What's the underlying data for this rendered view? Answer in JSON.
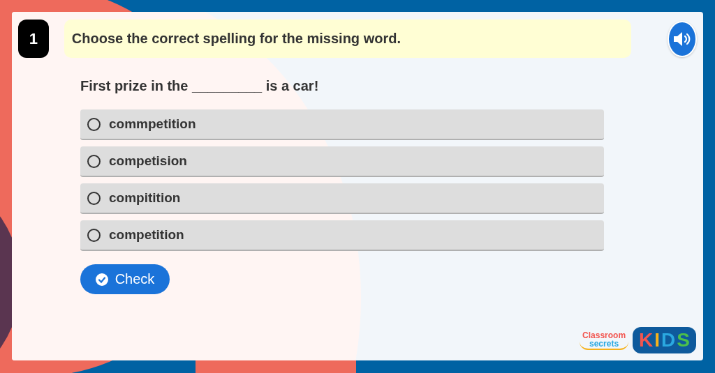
{
  "question_number": "1",
  "instruction": "Choose the correct spelling for the missing word.",
  "sentence": "First prize in the _________ is a car!",
  "options": [
    {
      "label": "commpetition",
      "selected": false
    },
    {
      "label": "competision",
      "selected": false
    },
    {
      "label": "compitition",
      "selected": false
    },
    {
      "label": "competition",
      "selected": false
    }
  ],
  "check_button": "Check",
  "logo": {
    "brand_top": "Classroom",
    "brand_bottom": "secrets",
    "kids_letters": [
      {
        "letter": "K",
        "color": "#f2554f"
      },
      {
        "letter": "I",
        "color": "#f6b21b"
      },
      {
        "letter": "D",
        "color": "#2aa8e0"
      },
      {
        "letter": "S",
        "color": "#4cbf4b"
      }
    ]
  }
}
